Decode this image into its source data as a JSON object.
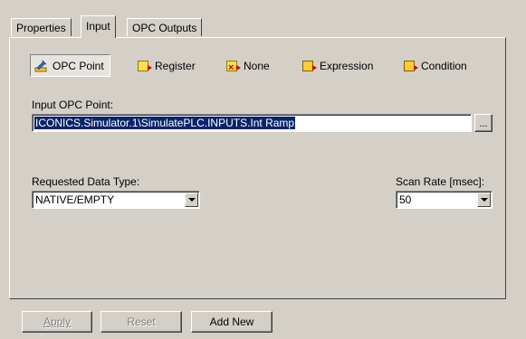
{
  "tabs": [
    {
      "label": "Properties"
    },
    {
      "label": "Input"
    },
    {
      "label": "OPC Outputs"
    }
  ],
  "options": [
    {
      "label": "OPC Point",
      "icon": "opc-point-icon",
      "selected": true
    },
    {
      "label": "Register",
      "icon": "register-icon",
      "selected": false
    },
    {
      "label": "None",
      "icon": "none-icon",
      "selected": false
    },
    {
      "label": "Expression",
      "icon": "expression-icon",
      "selected": false
    },
    {
      "label": "Condition",
      "icon": "condition-icon",
      "selected": false
    }
  ],
  "input_point": {
    "label": "Input OPC Point:",
    "value": "ICONICS.Simulator.1\\SimulatePLC.INPUTS.Int Ramp",
    "browse_label": "..."
  },
  "data_type": {
    "label": "Requested Data Type:",
    "value": "NATIVE/EMPTY"
  },
  "scan_rate": {
    "label": "Scan Rate [msec]:",
    "value": "50"
  },
  "buttons": {
    "apply": "Apply",
    "reset": "Reset",
    "add_new": "Add New"
  },
  "colors": {
    "face": "#d4d0c8",
    "selection": "#0a246a"
  }
}
